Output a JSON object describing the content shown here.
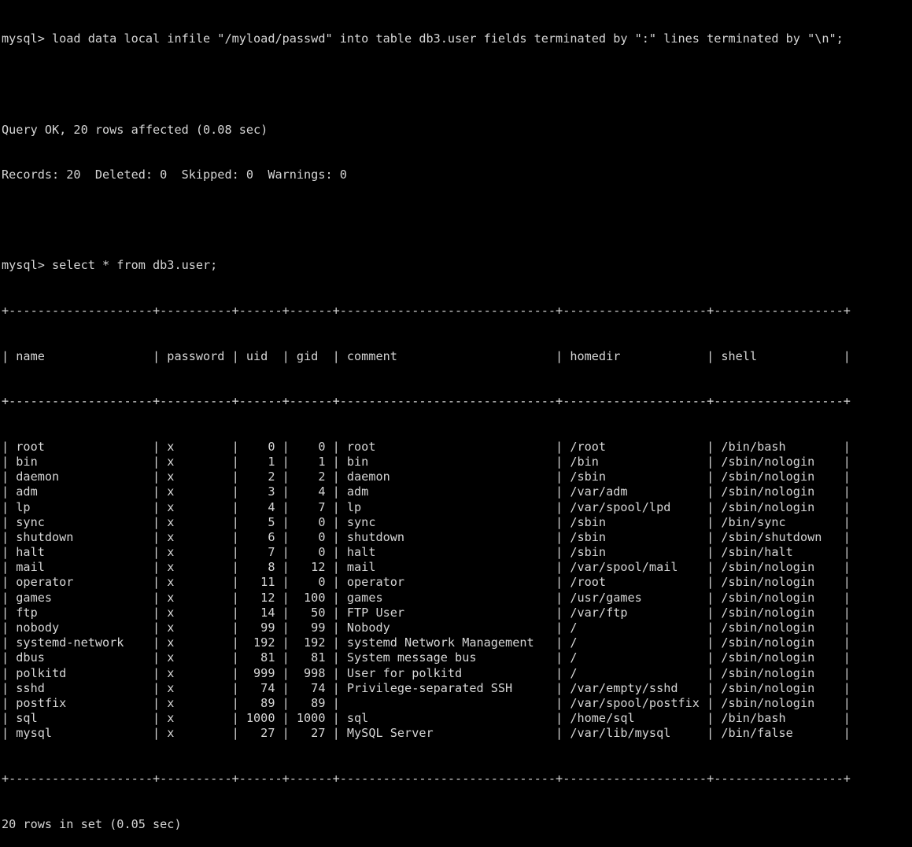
{
  "terminal": {
    "app": "mysql-client",
    "colors": {
      "background": "#000000",
      "foreground": "#d6d6d6"
    },
    "columns": 120,
    "prompt": "mysql> ",
    "statements": {
      "load_data": "mysql> load data local infile \"/myload/passwd\" into table db3.user fields terminated by \":\" lines terminated by \"\\n\";",
      "select": "mysql> select * from db3.user;"
    },
    "load_result": {
      "query_ok": "Query OK, 20 rows affected (0.08 sec)",
      "records_line": "Records: 20  Deleted: 0  Skipped: 0  Warnings: 0"
    },
    "footer": "20 rows in set (0.05 sec)"
  },
  "table": {
    "border": "+--------------------+----------+------+------+------------------------------+--------------------+------------------+",
    "columns": [
      {
        "name": "name",
        "width": 18,
        "align": "left"
      },
      {
        "name": "password",
        "width": 8,
        "align": "left"
      },
      {
        "name": "uid",
        "width": 4,
        "align": "right"
      },
      {
        "name": "gid",
        "width": 4,
        "align": "right"
      },
      {
        "name": "comment",
        "width": 28,
        "align": "left"
      },
      {
        "name": "homedir",
        "width": 18,
        "align": "left"
      },
      {
        "name": "shell",
        "width": 16,
        "align": "left"
      }
    ],
    "headers": [
      "name",
      "password",
      "uid",
      "gid",
      "comment",
      "homedir",
      "shell"
    ],
    "rows": [
      [
        "root",
        "x",
        "0",
        "0",
        "root",
        "/root",
        "/bin/bash"
      ],
      [
        "bin",
        "x",
        "1",
        "1",
        "bin",
        "/bin",
        "/sbin/nologin"
      ],
      [
        "daemon",
        "x",
        "2",
        "2",
        "daemon",
        "/sbin",
        "/sbin/nologin"
      ],
      [
        "adm",
        "x",
        "3",
        "4",
        "adm",
        "/var/adm",
        "/sbin/nologin"
      ],
      [
        "lp",
        "x",
        "4",
        "7",
        "lp",
        "/var/spool/lpd",
        "/sbin/nologin"
      ],
      [
        "sync",
        "x",
        "5",
        "0",
        "sync",
        "/sbin",
        "/bin/sync"
      ],
      [
        "shutdown",
        "x",
        "6",
        "0",
        "shutdown",
        "/sbin",
        "/sbin/shutdown"
      ],
      [
        "halt",
        "x",
        "7",
        "0",
        "halt",
        "/sbin",
        "/sbin/halt"
      ],
      [
        "mail",
        "x",
        "8",
        "12",
        "mail",
        "/var/spool/mail",
        "/sbin/nologin"
      ],
      [
        "operator",
        "x",
        "11",
        "0",
        "operator",
        "/root",
        "/sbin/nologin"
      ],
      [
        "games",
        "x",
        "12",
        "100",
        "games",
        "/usr/games",
        "/sbin/nologin"
      ],
      [
        "ftp",
        "x",
        "14",
        "50",
        "FTP User",
        "/var/ftp",
        "/sbin/nologin"
      ],
      [
        "nobody",
        "x",
        "99",
        "99",
        "Nobody",
        "/",
        "/sbin/nologin"
      ],
      [
        "systemd-network",
        "x",
        "192",
        "192",
        "systemd Network Management",
        "/",
        "/sbin/nologin"
      ],
      [
        "dbus",
        "x",
        "81",
        "81",
        "System message bus",
        "/",
        "/sbin/nologin"
      ],
      [
        "polkitd",
        "x",
        "999",
        "998",
        "User for polkitd",
        "/",
        "/sbin/nologin"
      ],
      [
        "sshd",
        "x",
        "74",
        "74",
        "Privilege-separated SSH",
        "/var/empty/sshd",
        "/sbin/nologin"
      ],
      [
        "postfix",
        "x",
        "89",
        "89",
        "",
        "/var/spool/postfix",
        "/sbin/nologin"
      ],
      [
        "sql",
        "x",
        "1000",
        "1000",
        "sql",
        "/home/sql",
        "/bin/bash"
      ],
      [
        "mysql",
        "x",
        "27",
        "27",
        "MySQL Server",
        "/var/lib/mysql",
        "/bin/false"
      ]
    ],
    "row_count": 20
  }
}
